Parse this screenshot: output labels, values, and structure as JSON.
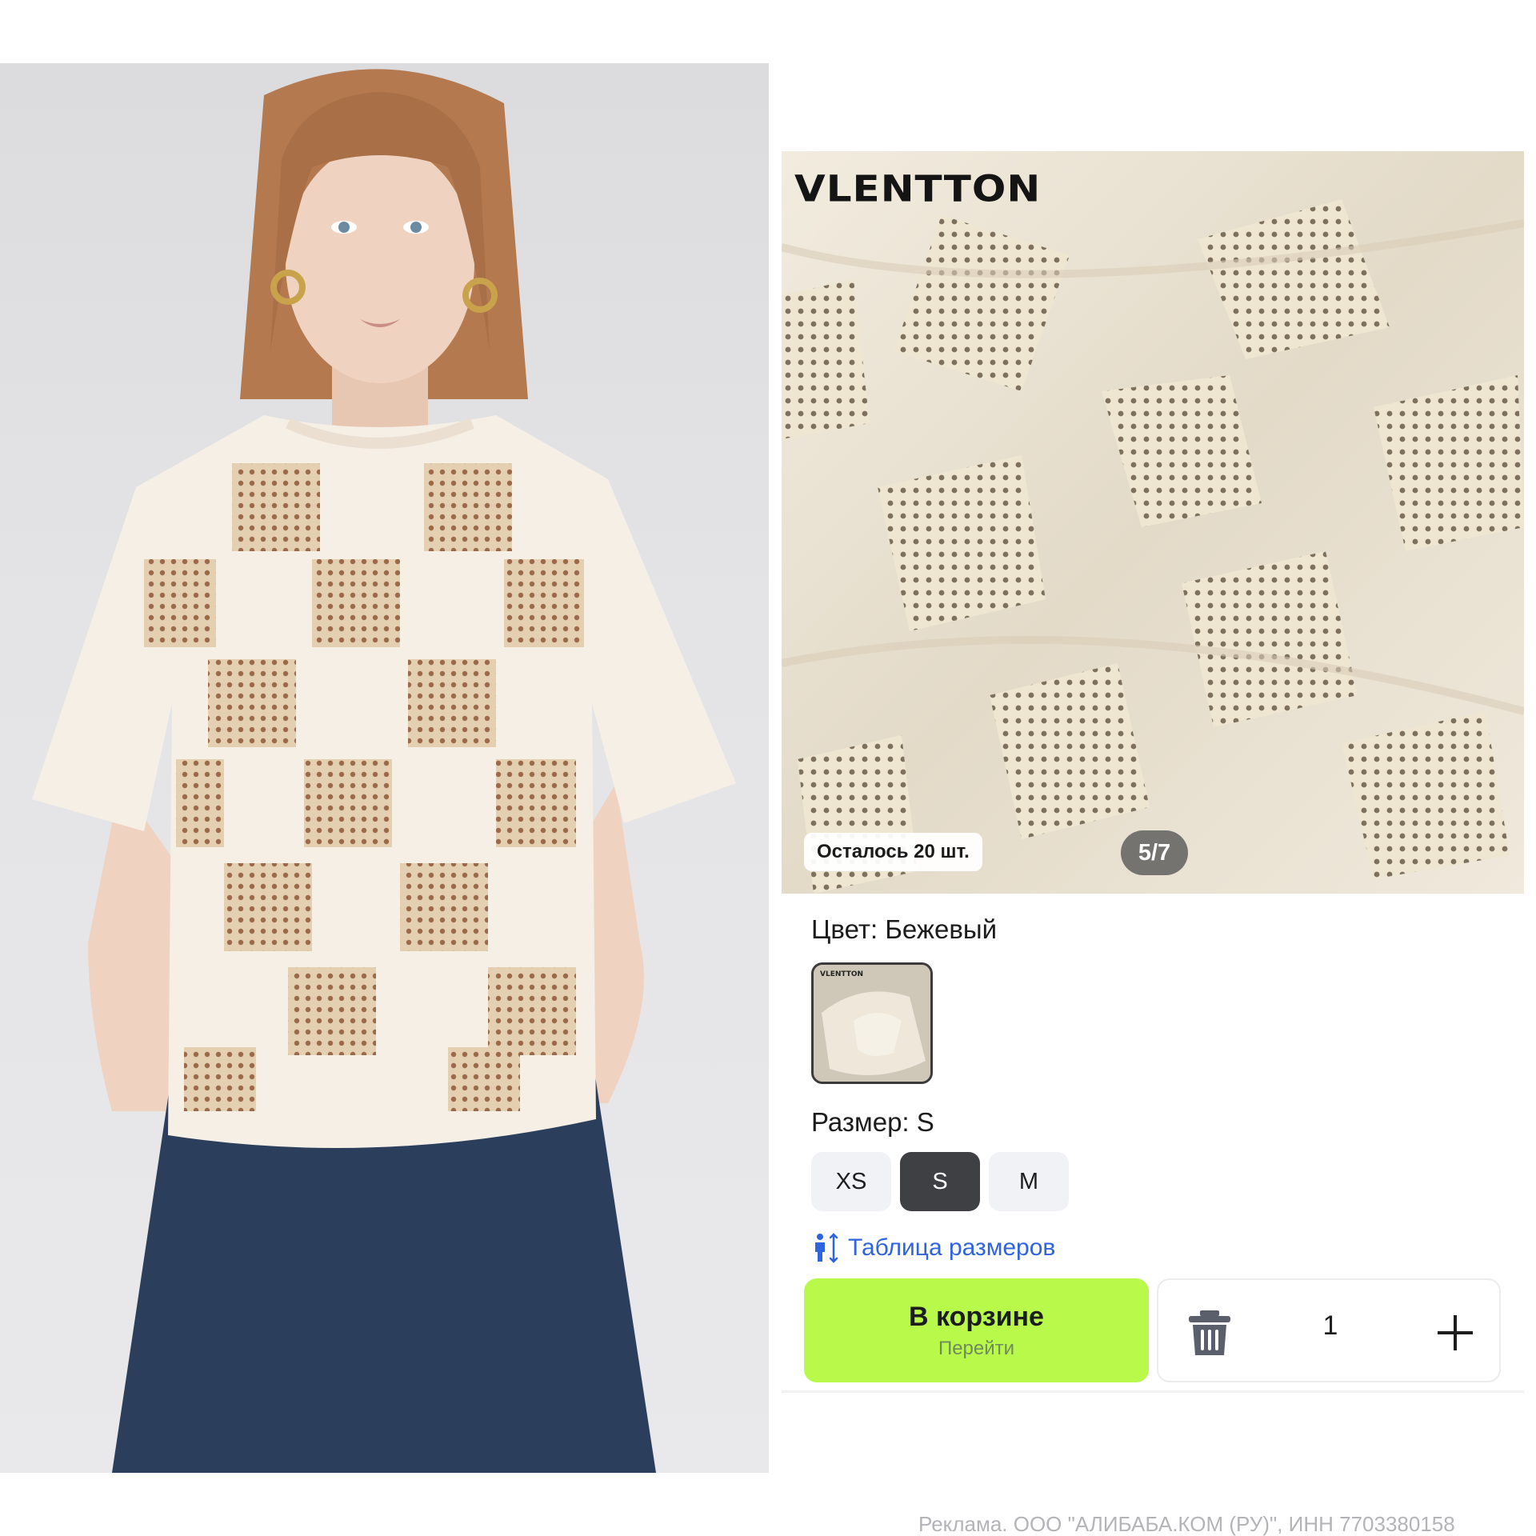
{
  "gallery": {
    "brand": "VLENTTON",
    "stock_badge": "Осталось 20 шт.",
    "page_counter": "5/7"
  },
  "color": {
    "label": "Цвет: Бежевый",
    "swatch_brand": "VLENTTON"
  },
  "size": {
    "label": "Размер: S",
    "options": [
      "XS",
      "S",
      "M"
    ],
    "selected": "S",
    "table_link": "Таблица размеров"
  },
  "cart": {
    "main_label": "В корзине",
    "sub_label": "Перейти",
    "quantity": "1"
  },
  "ad_note": "Реклама. ООО \"АЛИБАБА.КОМ (РУ)\", ИНН 7703380158",
  "colors": {
    "cart_green": "#b8f94a",
    "link_blue": "#2f63e0",
    "active_chip": "#3f4044",
    "fabric": "#ece6d9"
  },
  "icons": [
    "person-height-icon",
    "trash-icon",
    "plus-icon"
  ]
}
